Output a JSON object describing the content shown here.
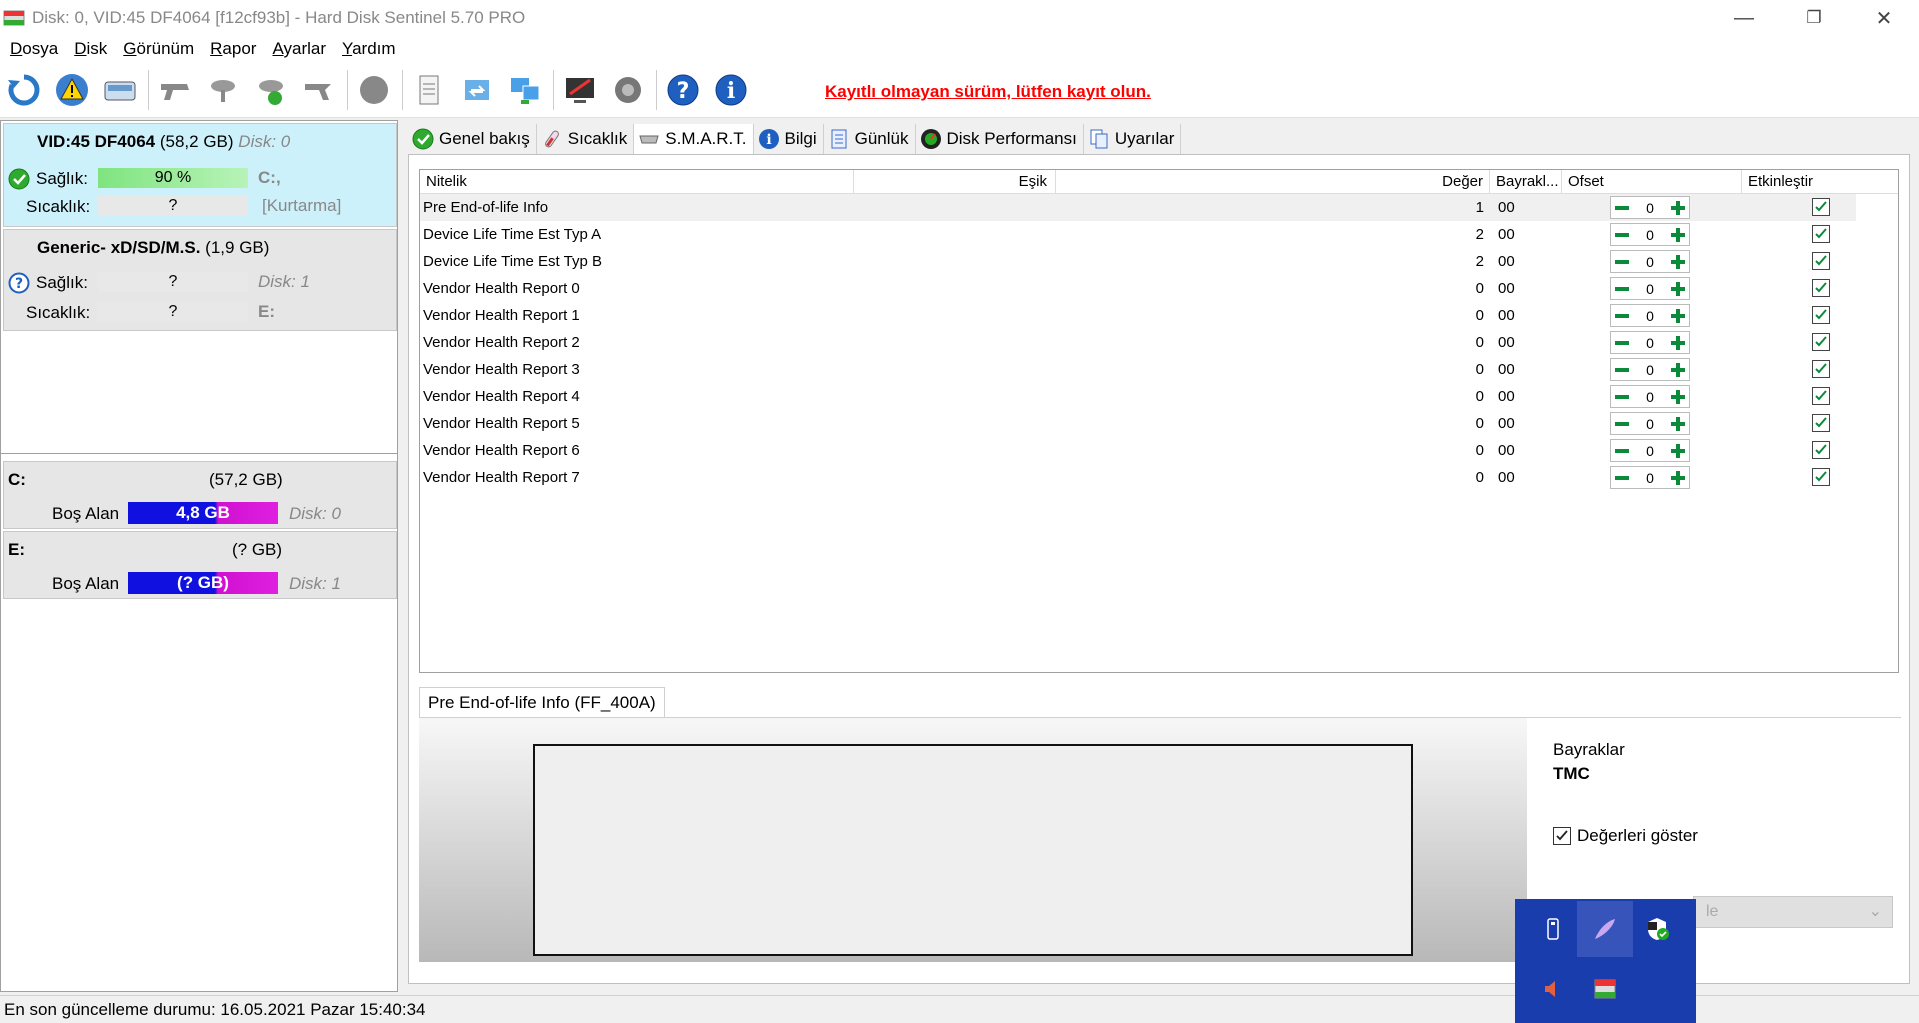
{
  "window": {
    "title": "Disk: 0, VID:45  DF4064 [f12cf93b]  -  Hard Disk Sentinel 5.70 PRO",
    "minimize": "—",
    "maximize": "❐",
    "close": "✕"
  },
  "menu": [
    {
      "ul": "D",
      "rest": "osya"
    },
    {
      "ul": "D",
      "rest": "isk"
    },
    {
      "ul": "G",
      "rest": "örünüm"
    },
    {
      "ul": "R",
      "rest": "apor"
    },
    {
      "ul": "A",
      "rest": "yarlar"
    },
    {
      "ul": "Y",
      "rest": "ardım"
    }
  ],
  "toolbar": {
    "register_link": "Kayıtlı olmayan sürüm, lütfen kayıt olun."
  },
  "disks": [
    {
      "id": "VID:45  DF4064",
      "size": "(58,2 GB)",
      "disk_label": "Disk: 0",
      "health_label": "Sağlık:",
      "health_value": "90 %",
      "temp_label": "Sıcaklık:",
      "temp_value": "?",
      "drive_letter": "C:,",
      "extra": "[Kurtarma]"
    },
    {
      "id": "Generic- xD/SD/M.S.",
      "size": "(1,9 GB)",
      "health_label": "Sağlık:",
      "health_value": "?",
      "temp_label": "Sıcaklık:",
      "temp_value": "?",
      "disk_label": "Disk: 1",
      "drive_letter": "E:"
    }
  ],
  "volumes": [
    {
      "letter": "C:",
      "size": "(57,2 GB)",
      "free_label": "Boş Alan",
      "free_value": "4,8 GB",
      "disk": "Disk: 0"
    },
    {
      "letter": "E:",
      "size": "(? GB)",
      "free_label": "Boş Alan",
      "free_value": "(? GB)",
      "disk": "Disk: 1"
    }
  ],
  "tabs": [
    "Genel bakış",
    "Sıcaklık",
    "S.M.A.R.T.",
    "Bilgi",
    "Günlük",
    "Disk Performansı",
    "Uyarılar"
  ],
  "smart": {
    "headers": {
      "attribute": "Nitelik",
      "threshold": "Eşik",
      "value": "Değer",
      "flags": "Bayrakl...",
      "offset": "Ofset",
      "enable": "Etkinleştir"
    },
    "rows": [
      {
        "name": "Pre End-of-life Info",
        "value": "1",
        "flags": "00",
        "offset": "0"
      },
      {
        "name": "Device Life Time Est Typ A",
        "value": "2",
        "flags": "00",
        "offset": "0"
      },
      {
        "name": "Device Life Time Est Typ B",
        "value": "2",
        "flags": "00",
        "offset": "0"
      },
      {
        "name": "Vendor Health Report 0",
        "value": "0",
        "flags": "00",
        "offset": "0"
      },
      {
        "name": "Vendor Health Report 1",
        "value": "0",
        "flags": "00",
        "offset": "0"
      },
      {
        "name": "Vendor Health Report 2",
        "value": "0",
        "flags": "00",
        "offset": "0"
      },
      {
        "name": "Vendor Health Report 3",
        "value": "0",
        "flags": "00",
        "offset": "0"
      },
      {
        "name": "Vendor Health Report 4",
        "value": "0",
        "flags": "00",
        "offset": "0"
      },
      {
        "name": "Vendor Health Report 5",
        "value": "0",
        "flags": "00",
        "offset": "0"
      },
      {
        "name": "Vendor Health Report 6",
        "value": "0",
        "flags": "00",
        "offset": "0"
      },
      {
        "name": "Vendor Health Report 7",
        "value": "0",
        "flags": "00",
        "offset": "0"
      }
    ]
  },
  "detail": {
    "tab": "Pre End-of-life Info (FF_400A)",
    "flags_title": "Bayraklar",
    "flags_value": "TMC",
    "show_values": "Değerleri göster",
    "combo_value": "le"
  },
  "status": {
    "text": "En son güncelleme durumu: 16.05.2021 Pazar 15:40:34"
  },
  "colors": {
    "accent_red": "#ff0000",
    "selected_disk": "#cdf1fb",
    "health_green": "#7fe47f",
    "tray_bg": "#1a3dae"
  }
}
